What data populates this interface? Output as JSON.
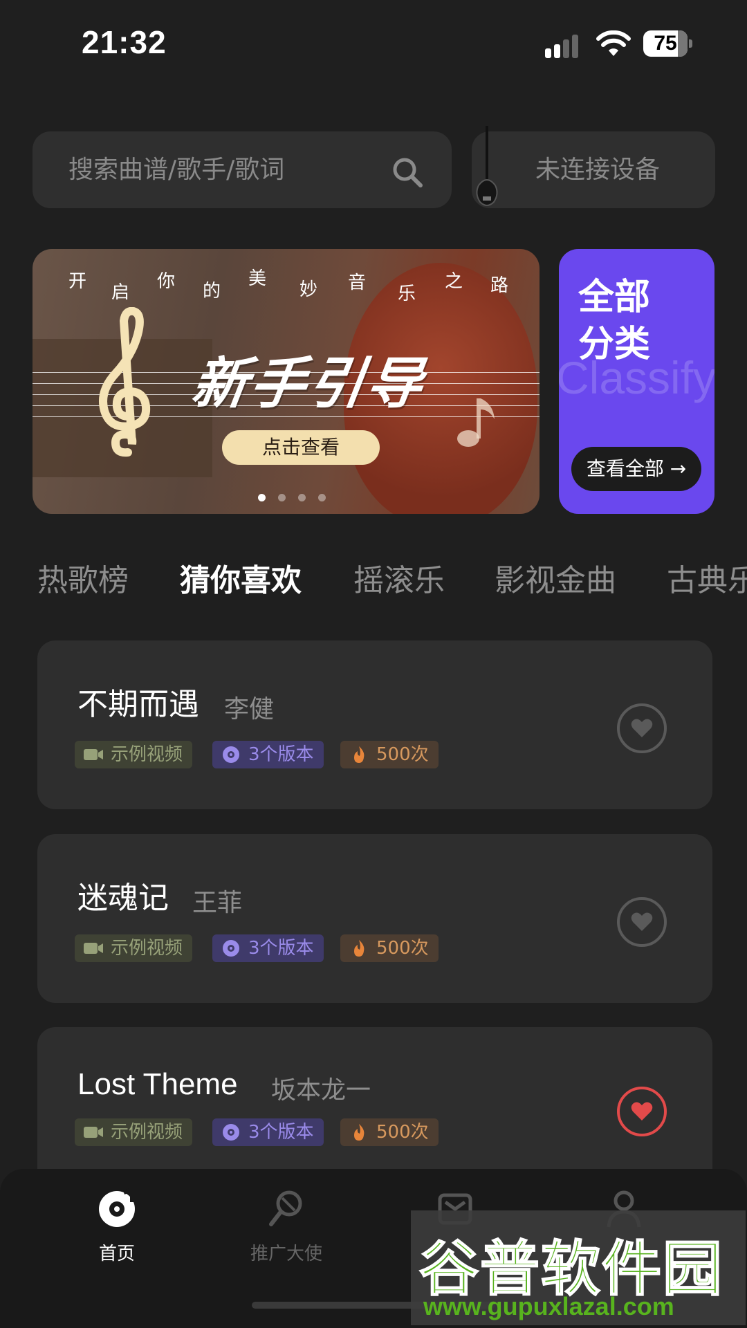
{
  "status_bar": {
    "time": "21:32",
    "battery": "75"
  },
  "search": {
    "placeholder": "搜索曲谱/歌手/歌词"
  },
  "device": {
    "label": "未连接设备"
  },
  "banner": {
    "tagline": [
      "开",
      "启",
      "你",
      "的",
      "美",
      "妙",
      "音",
      "乐",
      "之",
      "路"
    ],
    "title": "新手引导",
    "cta": "点击查看",
    "page_count": 4,
    "active_page": 0
  },
  "category_card": {
    "title_line1": "全部",
    "title_line2": "分类",
    "watermark": "Classify",
    "view_all": "查看全部 →",
    "color": "#6a48ee"
  },
  "tabs": [
    {
      "label": "热歌榜",
      "active": false
    },
    {
      "label": "猜你喜欢",
      "active": true
    },
    {
      "label": "摇滚乐",
      "active": false
    },
    {
      "label": "影视金曲",
      "active": false
    },
    {
      "label": "古典乐",
      "active": false
    }
  ],
  "songs": [
    {
      "title": "不期而遇",
      "artist": "李健",
      "video": "示例视频",
      "versions": "3个版本",
      "plays": "500次",
      "favorited": false
    },
    {
      "title": "迷魂记",
      "artist": "王菲",
      "video": "示例视频",
      "versions": "3个版本",
      "plays": "500次",
      "favorited": false
    },
    {
      "title": "Lost Theme",
      "artist": "坂本龙一",
      "video": "示例视频",
      "versions": "3个版本",
      "plays": "500次",
      "favorited": true
    }
  ],
  "bottom_nav": [
    {
      "label": "首页",
      "icon": "home-disc-icon",
      "active": true
    },
    {
      "label": "推广大使",
      "icon": "microphone-icon",
      "active": false
    },
    {
      "label": "",
      "icon": "message-icon",
      "active": false
    },
    {
      "label": "",
      "icon": "profile-icon",
      "active": false
    }
  ],
  "site_watermark": {
    "brand": "谷普软件园",
    "url": "www.gupuxlazal.com"
  },
  "colors": {
    "background": "#1f1f1f",
    "card": "#2e2e2e",
    "accent_purple": "#6a48ee",
    "favorite_red": "#e24a4a"
  }
}
